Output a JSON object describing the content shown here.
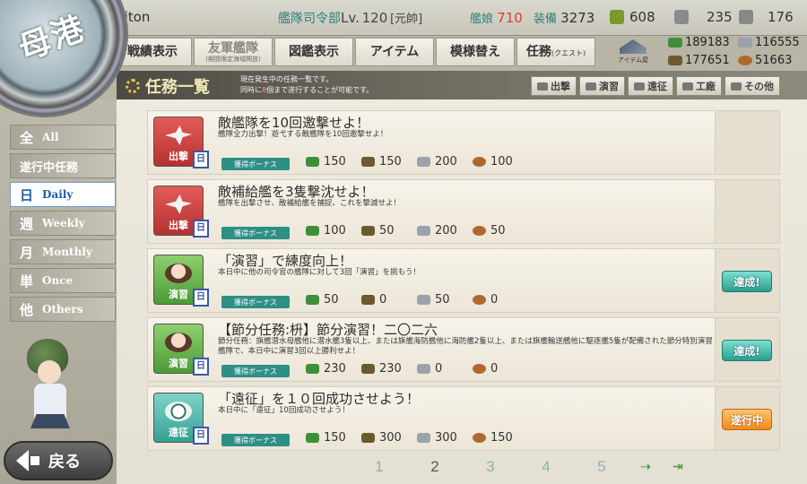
{
  "header": {
    "player_name": "kiton",
    "hq_label": "艦隊司令部",
    "level_label": "Lv.",
    "level": "120",
    "rank": "[元帥]",
    "ships_label": "艦娘",
    "ships_count": "710",
    "equip_label": "装備",
    "equip_count": "3273",
    "bucket": "608",
    "dev_material": "235",
    "screw": "176"
  },
  "emblem_text": "母港",
  "nav": {
    "record": "戦績表示",
    "friend": "友軍艦隊",
    "friend_sub": "(期間限定海域開放)",
    "library": "図鑑表示",
    "item": "アイテム",
    "remodel": "模様替え",
    "quest": "任務",
    "quest_sub": "(クエスト)",
    "akashi": "アイテム屋"
  },
  "materials": {
    "fuel": "189183",
    "steel": "116555",
    "ammo": "177651",
    "bauxite": "51663"
  },
  "strip": {
    "title": "任務一覧",
    "desc_line1": "現在発生中の任務一覧です。",
    "desc_line2_a": "同時に",
    "desc_line2_hl": "8",
    "desc_line2_b": "個まで遂行することが可能です。",
    "tabs": [
      "出撃",
      "演習",
      "遠征",
      "工廠",
      "その他"
    ]
  },
  "filters": [
    {
      "k": "全",
      "e": "All"
    },
    {
      "k": "遂行中任務",
      "e": ""
    },
    {
      "k": "日",
      "e": "Daily"
    },
    {
      "k": "週",
      "e": "Weekly"
    },
    {
      "k": "月",
      "e": "Monthly"
    },
    {
      "k": "単",
      "e": "Once"
    },
    {
      "k": "他",
      "e": "Others"
    }
  ],
  "back_label": "戻る",
  "bonus_label": "獲得ボーナス",
  "stamp": "日",
  "quests": [
    {
      "category": "出撃",
      "title": "敵艦隊を10回邀撃せよ！",
      "desc": "艦隊全力出撃！遊弋する敵艦隊を10回邀撃せよ！",
      "fuel": "150",
      "ammo": "150",
      "steel": "200",
      "bauxite": "100",
      "status": ""
    },
    {
      "category": "出撃",
      "title": "敵補給艦を3隻撃沈せよ！",
      "desc": "艦隊を出撃させ、敵補給艦を捕捉、これを撃滅せよ！",
      "fuel": "100",
      "ammo": "50",
      "steel": "200",
      "bauxite": "50",
      "status": ""
    },
    {
      "category": "演習",
      "title": "「演習」で練度向上！",
      "desc": "本日中に他の司令官の艦隊に対して3回「演習」を挑もう！",
      "fuel": "50",
      "ammo": "0",
      "steel": "50",
      "bauxite": "0",
      "status": "達成!"
    },
    {
      "category": "演習",
      "title": "【節分任務:枡】節分演習！二〇二六",
      "desc": "節分任務：旗艦潜水母艦他に潜水艦3隻以上、または旗艦海防艦他に海防艦2隻以上、または旗艦輸送艦他に駆逐艦5隻が配備された節分特別演習艦隊で、本日中に演習3回以上勝利せよ！",
      "fuel": "230",
      "ammo": "230",
      "steel": "0",
      "bauxite": "0",
      "status": "達成!"
    },
    {
      "category": "遠征",
      "title": "「遠征」を１０回成功させよう！",
      "desc": "本日中に「遠征」10回成功させよう！",
      "fuel": "150",
      "ammo": "300",
      "steel": "300",
      "bauxite": "150",
      "status": "遂行中"
    }
  ],
  "pager": {
    "pages": [
      "1",
      "2",
      "3",
      "4",
      "5"
    ],
    "current": "2"
  },
  "colors": {
    "accent_teal": "#2d8f87",
    "done": "#2a9e8f",
    "in_progress": "#f08a1d",
    "sortie": "#b53131",
    "practice": "#4c9a39",
    "expedition": "#35a092"
  }
}
